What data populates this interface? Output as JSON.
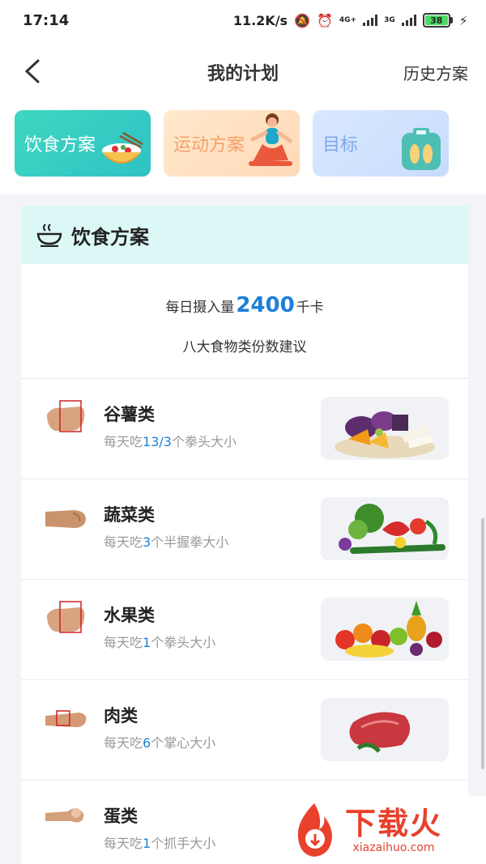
{
  "status_bar": {
    "time": "17:14",
    "speed": "11.2K/s",
    "net1": "4G+",
    "net2": "3G",
    "battery": "38"
  },
  "header": {
    "title": "我的计划",
    "history": "历史方案"
  },
  "tabs": [
    {
      "label": "饮食方案",
      "active": true
    },
    {
      "label": "运动方案",
      "active": false
    },
    {
      "label": "目标",
      "active": false
    }
  ],
  "diet": {
    "heading": "饮食方案",
    "intake_prefix": "每日摄入量",
    "intake_value": "2400",
    "intake_unit": "千卡",
    "suggestion": "八大食物类份数建议"
  },
  "foods": [
    {
      "name": "谷薯类",
      "prefix": "每天吃",
      "amount": "13/3",
      "suffix": "个拳头大小"
    },
    {
      "name": "蔬菜类",
      "prefix": "每天吃",
      "amount": "3",
      "suffix": "个半握拳大小"
    },
    {
      "name": "水果类",
      "prefix": "每天吃",
      "amount": "1",
      "suffix": "个拳头大小"
    },
    {
      "name": "肉类",
      "prefix": "每天吃",
      "amount": "6",
      "suffix": "个掌心大小"
    },
    {
      "name": "蛋类",
      "prefix": "每天吃",
      "amount": "1",
      "suffix": "个抓手大小"
    }
  ],
  "watermark": {
    "title": "下载火",
    "url": "xiazaihuo.com"
  },
  "colors": {
    "accent_blue": "#1d7fd8",
    "diet_tab": "#3fd7c0",
    "sport_tab": "#ffd9b8",
    "goal_tab": "#c8dcfb",
    "header_band": "#dcf8f6"
  }
}
